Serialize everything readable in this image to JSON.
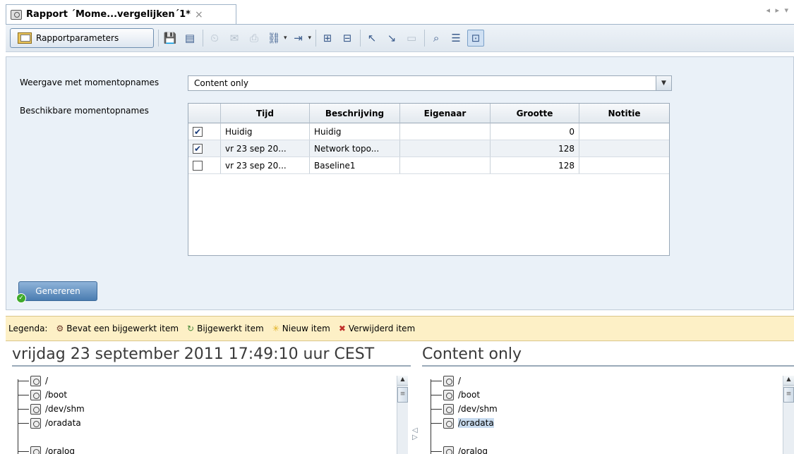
{
  "tab": {
    "title": "Rapport ´Mome...vergelijken´1*",
    "close": "×",
    "nav": "◂ ▸ ▾"
  },
  "toolbar": {
    "report_params_label": "Rapportparameters"
  },
  "params": {
    "view_label": "Weergave met momentopnames",
    "view_value": "Content only",
    "available_label": "Beschikbare momentopnames",
    "columns": [
      "Tijd",
      "Beschrijving",
      "Eigenaar",
      "Grootte",
      "Notitie"
    ],
    "rows": [
      {
        "checked": true,
        "tijd": "Huidig",
        "beschrijving": "Huidig",
        "eigenaar": "",
        "grootte": "0",
        "notitie": ""
      },
      {
        "checked": true,
        "tijd": "vr 23 sep 20...",
        "beschrijving": "Network topo...",
        "eigenaar": "",
        "grootte": "128",
        "notitie": ""
      },
      {
        "checked": false,
        "tijd": "vr 23 sep 20...",
        "beschrijving": "Baseline1",
        "eigenaar": "",
        "grootte": "128",
        "notitie": ""
      }
    ],
    "generate_label": "Genereren"
  },
  "legend": {
    "title": "Legenda:",
    "items": [
      {
        "icon": "⚙",
        "label": "Bevat een bijgewerkt item",
        "color": "#6b3a2a"
      },
      {
        "icon": "↻",
        "label": "Bijgewerkt item",
        "color": "#4a8a3a"
      },
      {
        "icon": "✳",
        "label": "Nieuw item",
        "color": "#e0b020"
      },
      {
        "icon": "✖",
        "label": "Verwijderd item",
        "color": "#c0302a"
      }
    ]
  },
  "compare": {
    "left_title": "vrijdag 23 september 2011 17:49:10 uur CEST",
    "right_title": "Content only",
    "left_items": [
      "/",
      "/boot",
      "/dev/shm",
      "/oradata",
      "/oralog"
    ],
    "right_items": [
      "/",
      "/boot",
      "/dev/shm",
      "/oradata",
      "/oralog"
    ],
    "right_selected_index": 3
  }
}
